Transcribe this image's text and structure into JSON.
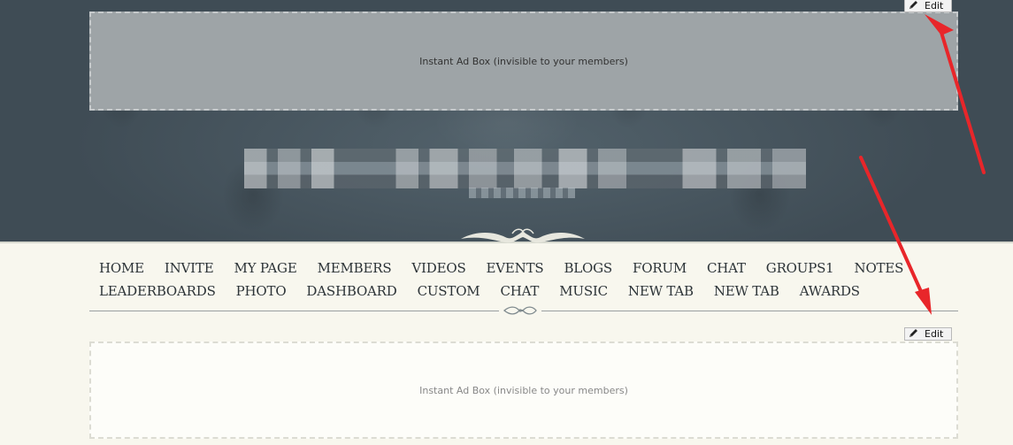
{
  "header": {
    "ad_box_text": "Instant Ad Box (invisible to your members)",
    "edit_label": "Edit"
  },
  "nav": {
    "row1": [
      "HOME",
      "INVITE",
      "MY PAGE",
      "MEMBERS",
      "VIDEOS",
      "EVENTS",
      "BLOGS",
      "FORUM",
      "CHAT",
      "GROUPS1",
      "NOTES"
    ],
    "row2": [
      "LEADERBOARDS",
      "PHOTO",
      "DASHBOARD",
      "CUSTOM",
      "CHAT",
      "MUSIC",
      "NEW TAB",
      "NEW TAB",
      "AWARDS"
    ]
  },
  "content": {
    "ad_box_text": "Instant Ad Box (invisible to your members)",
    "edit_label": "Edit"
  },
  "colors": {
    "header_bg": "#3f4c55",
    "page_bg": "#f8f7ee",
    "nav_text": "#2d3438",
    "annotation_arrow": "#e8262a"
  },
  "icons": {
    "edit": "pencil-icon"
  }
}
